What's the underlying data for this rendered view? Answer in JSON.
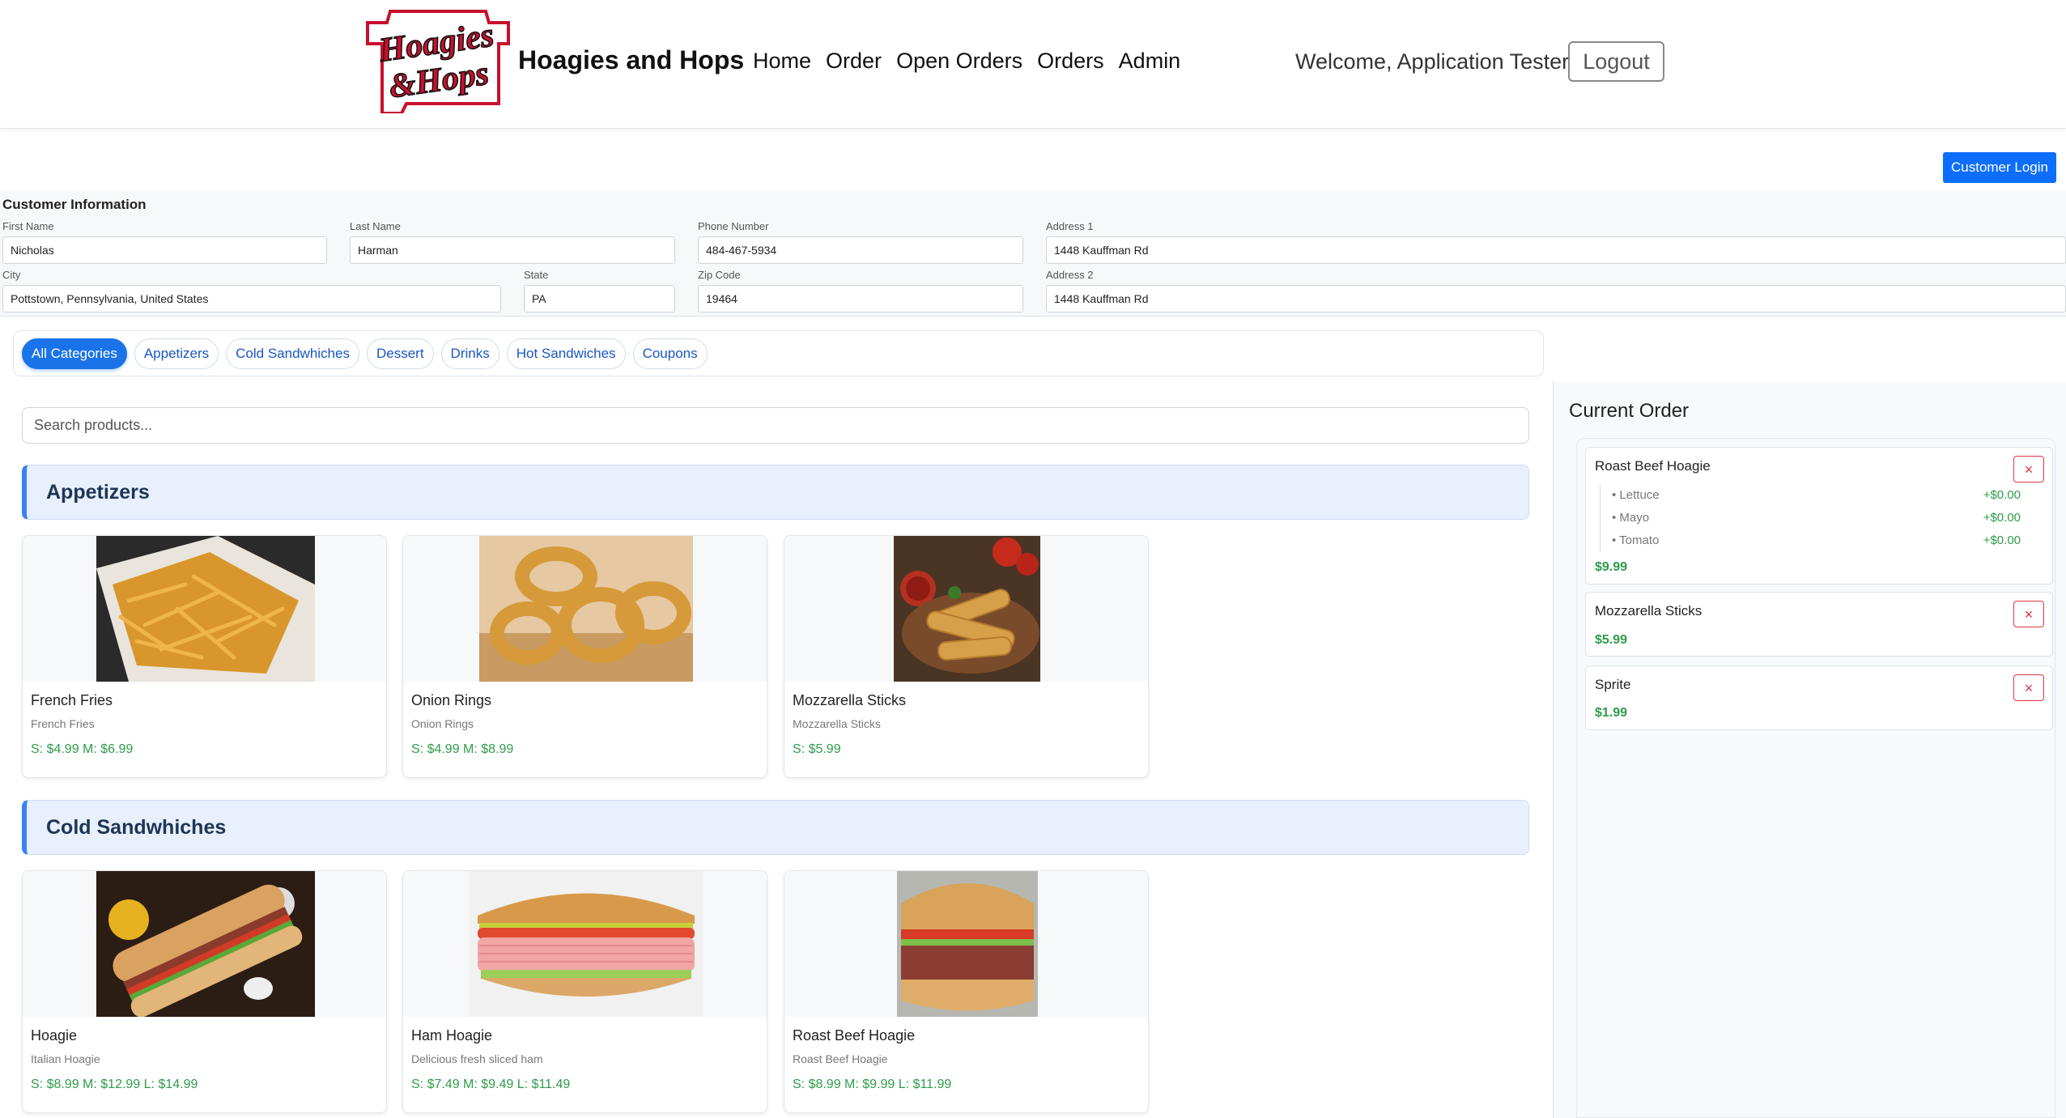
{
  "brand": {
    "name": "Hoagies and Hops",
    "logo_line1": "Hoagies",
    "logo_line2": "&Hops"
  },
  "nav": [
    "Home",
    "Order",
    "Open Orders",
    "Orders",
    "Admin"
  ],
  "user": {
    "welcome": "Welcome, Application Tester",
    "logout": "Logout"
  },
  "customer_login": "Customer Login",
  "customer": {
    "title": "Customer Information",
    "first_name": {
      "label": "First Name",
      "value": "Nicholas"
    },
    "last_name": {
      "label": "Last Name",
      "value": "Harman"
    },
    "phone": {
      "label": "Phone Number",
      "value": "484-467-5934"
    },
    "address1": {
      "label": "Address 1",
      "value": "1448 Kauffman Rd"
    },
    "city": {
      "label": "City",
      "value": "Pottstown, Pennsylvania, United States"
    },
    "state": {
      "label": "State",
      "value": "PA"
    },
    "zip": {
      "label": "Zip Code",
      "value": "19464"
    },
    "address2": {
      "label": "Address 2",
      "value": "1448 Kauffman Rd"
    }
  },
  "categories": [
    "All Categories",
    "Appetizers",
    "Cold Sandwhiches",
    "Dessert",
    "Drinks",
    "Hot Sandwiches",
    "Coupons"
  ],
  "active_category": "All Categories",
  "search_placeholder": "Search products...",
  "sections": [
    {
      "title": "Appetizers",
      "products": [
        {
          "name": "French Fries",
          "desc": "French Fries",
          "price": "S: $4.99 M: $6.99",
          "image": "fries"
        },
        {
          "name": "Onion Rings",
          "desc": "Onion Rings",
          "price": "S: $4.99 M: $8.99",
          "image": "onion-rings"
        },
        {
          "name": "Mozzarella Sticks",
          "desc": "Mozzarella Sticks",
          "price": "S: $5.99",
          "image": "mozzarella-sticks"
        }
      ]
    },
    {
      "title": "Cold Sandwhiches",
      "products": [
        {
          "name": "Hoagie",
          "desc": "Italian Hoagie",
          "price": "S: $8.99 M: $12.99 L: $14.99",
          "image": "hoagie"
        },
        {
          "name": "Ham Hoagie",
          "desc": "Delicious fresh sliced ham",
          "price": "S: $7.49 M: $9.49 L: $11.49",
          "image": "ham-hoagie"
        },
        {
          "name": "Roast Beef Hoagie",
          "desc": "Roast Beef Hoagie",
          "price": "S: $8.99 M: $9.99 L: $11.99",
          "image": "roast-beef-hoagie"
        }
      ]
    }
  ],
  "order": {
    "title": "Current Order",
    "remove_symbol": "×",
    "items": [
      {
        "name": "Roast Beef Hoagie",
        "price": "$9.99",
        "mods": [
          {
            "name": "• Lettuce",
            "price": "+$0.00"
          },
          {
            "name": "• Mayo",
            "price": "+$0.00"
          },
          {
            "name": "• Tomato",
            "price": "+$0.00"
          }
        ]
      },
      {
        "name": "Mozzarella Sticks",
        "price": "$5.99",
        "mods": []
      },
      {
        "name": "Sprite",
        "price": "$1.99",
        "mods": []
      }
    ]
  },
  "colors": {
    "primary": "#0d6efd",
    "price_green": "#2e9c4a",
    "danger": "#dc3545",
    "logo_red": "#c8102e"
  }
}
